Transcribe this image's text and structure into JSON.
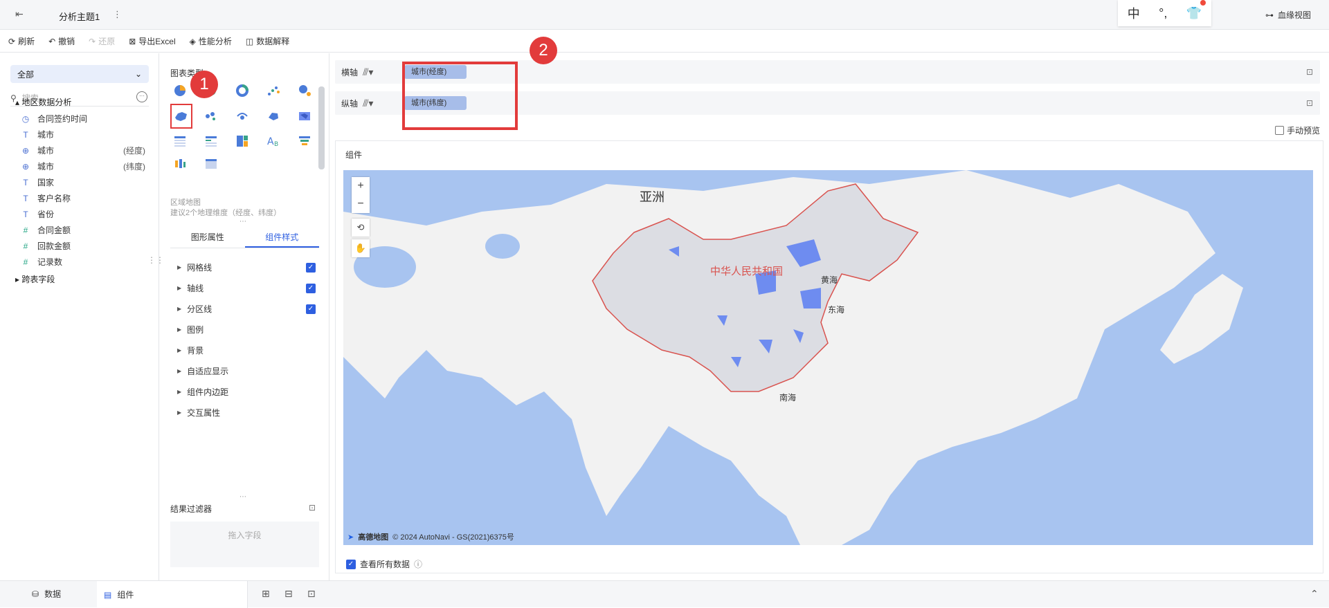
{
  "topbar": {
    "title": "分析主题1",
    "tools": [
      "中",
      "°,",
      "👕"
    ],
    "lineage_label": "血缘视图"
  },
  "toolbar": {
    "refresh": "刷新",
    "undo": "撤销",
    "redo": "还原",
    "export": "导出Excel",
    "perf": "性能分析",
    "explain": "数据解释"
  },
  "left": {
    "select": "全部",
    "search_placeholder": "搜索",
    "group": "地区数据分析",
    "fields": [
      {
        "icon": "clock",
        "name": "合同签约时间",
        "ext": ""
      },
      {
        "icon": "T",
        "name": "城市",
        "ext": ""
      },
      {
        "icon": "globe",
        "name": "城市",
        "ext": "(经度)"
      },
      {
        "icon": "globe",
        "name": "城市",
        "ext": "(纬度)"
      },
      {
        "icon": "T",
        "name": "国家",
        "ext": ""
      },
      {
        "icon": "T",
        "name": "客户名称",
        "ext": ""
      },
      {
        "icon": "T",
        "name": "省份",
        "ext": ""
      },
      {
        "icon": "#",
        "name": "合同金额",
        "ext": ""
      },
      {
        "icon": "#",
        "name": "回款金额",
        "ext": ""
      },
      {
        "icon": "#",
        "name": "记录数",
        "ext": ""
      }
    ],
    "cross_table": "跨表字段"
  },
  "mid": {
    "chart_type_label": "图表类型",
    "hint1": "区域地图",
    "hint2": "建议2个地理维度（经度、纬度）",
    "tabs": [
      "图形属性",
      "组件样式"
    ],
    "props": [
      {
        "label": "网格线",
        "checked": true
      },
      {
        "label": "轴线",
        "checked": true
      },
      {
        "label": "分区线",
        "checked": true
      },
      {
        "label": "图例",
        "checked": false
      },
      {
        "label": "背景",
        "checked": false
      },
      {
        "label": "自适应显示",
        "checked": false
      },
      {
        "label": "组件内边距",
        "checked": false
      },
      {
        "label": "交互属性",
        "checked": false
      }
    ],
    "filter_label": "结果过滤器",
    "filter_drop": "拖入字段"
  },
  "axes": {
    "x_label": "横轴",
    "x_field": "城市(经度)",
    "y_label": "纵轴",
    "y_field": "城市(纬度)"
  },
  "badges": [
    "1",
    "2"
  ],
  "manual_preview": "手动预览",
  "component_title": "组件",
  "map": {
    "asia": "亚洲",
    "china": "中华人民共和国",
    "yellow_sea": "黄海",
    "east_sea": "东海",
    "south_sea": "南海",
    "attribution": "© 2024 AutoNavi - GS(2021)6375号",
    "brand": "高德地图",
    "colors": {
      "water": "#a8c4f0",
      "land": "#f2f2f2",
      "china": "#dcdde3",
      "highlight": "#6e8cf0",
      "border": "#d9534f"
    }
  },
  "view_all": "查看所有数据",
  "bottom": {
    "data": "数据",
    "component": "组件"
  }
}
